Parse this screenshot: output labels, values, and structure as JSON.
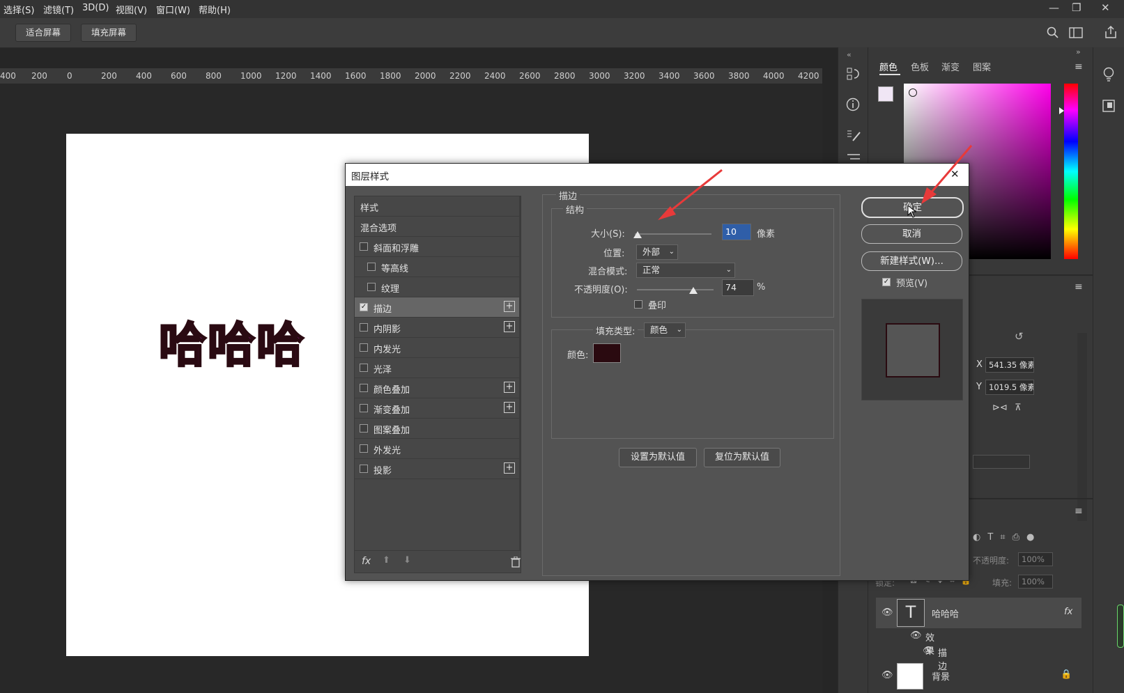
{
  "menu": [
    "选择(S)",
    "滤镜(T)",
    "3D(D)",
    "视图(V)",
    "窗口(W)",
    "帮助(H)"
  ],
  "window_controls": {
    "minimize": "—",
    "restore": "❐",
    "close": "✕"
  },
  "options_bar": {
    "fit_screen": "适合屏幕",
    "fill_screen": "填充屏幕"
  },
  "ruler_ticks": [
    "400",
    "200",
    "0",
    "200",
    "400",
    "600",
    "800",
    "1000",
    "1200",
    "1400",
    "1600",
    "1800",
    "2000",
    "2200",
    "2400",
    "2600",
    "2800",
    "3000",
    "3200",
    "3400",
    "3600",
    "3800",
    "4000",
    "4200"
  ],
  "canvas": {
    "text": "哈哈哈",
    "text_color": "#e21de0",
    "stroke_color": "#2a0a12"
  },
  "color_panel": {
    "tabs": [
      "颜色",
      "色板",
      "渐变",
      "图案"
    ],
    "hue_color": "#ff00ea"
  },
  "properties": {
    "x_label": "X",
    "x_value": "541.35 像素",
    "y_label": "Y",
    "y_value": "1019.5 像素"
  },
  "layers_panel": {
    "opacity_label": "不透明度:",
    "opacity_value": "100%",
    "lock_label": "锁定:",
    "fill_label": "填充:",
    "fill_value": "100%",
    "layers": [
      {
        "name": "哈哈哈",
        "fx": "fx",
        "effects_label": "效果",
        "effect": "描边"
      },
      {
        "name": "背景"
      }
    ]
  },
  "dialog": {
    "title": "图层样式",
    "close": "✕",
    "style_list": {
      "header": "样式",
      "blend": "混合选项",
      "items": [
        {
          "label": "斜面和浮雕",
          "checked": false,
          "plus": false,
          "indent": false
        },
        {
          "label": "等高线",
          "checked": false,
          "plus": false,
          "indent": true
        },
        {
          "label": "纹理",
          "checked": false,
          "plus": false,
          "indent": true
        },
        {
          "label": "描边",
          "checked": true,
          "plus": true,
          "indent": false,
          "selected": true
        },
        {
          "label": "内阴影",
          "checked": false,
          "plus": true,
          "indent": false
        },
        {
          "label": "内发光",
          "checked": false,
          "plus": false,
          "indent": false
        },
        {
          "label": "光泽",
          "checked": false,
          "plus": false,
          "indent": false
        },
        {
          "label": "颜色叠加",
          "checked": false,
          "plus": true,
          "indent": false
        },
        {
          "label": "渐变叠加",
          "checked": false,
          "plus": true,
          "indent": false
        },
        {
          "label": "图案叠加",
          "checked": false,
          "plus": false,
          "indent": false
        },
        {
          "label": "外发光",
          "checked": false,
          "plus": false,
          "indent": false
        },
        {
          "label": "投影",
          "checked": false,
          "plus": true,
          "indent": false
        }
      ],
      "footer_fx": "fx"
    },
    "stroke": {
      "section": "描边",
      "structure": "结构",
      "size_label": "大小(S):",
      "size_value": "10",
      "size_unit": "像素",
      "size_fraction": 0.04,
      "position_label": "位置:",
      "position_value": "外部",
      "blend_label": "混合模式:",
      "blend_value": "正常",
      "opacity_label": "不透明度(O):",
      "opacity_value": "74",
      "opacity_unit": "%",
      "opacity_fraction": 0.74,
      "overprint_label": "叠印",
      "fill_type_label": "填充类型:",
      "fill_type_value": "颜色",
      "color_label": "颜色:",
      "color_value": "#2a0a10",
      "set_default": "设置为默认值",
      "reset_default": "复位为默认值"
    },
    "buttons": {
      "ok": "确定",
      "cancel": "取消",
      "new_style": "新建样式(W)...",
      "preview": "预览(V)"
    }
  }
}
